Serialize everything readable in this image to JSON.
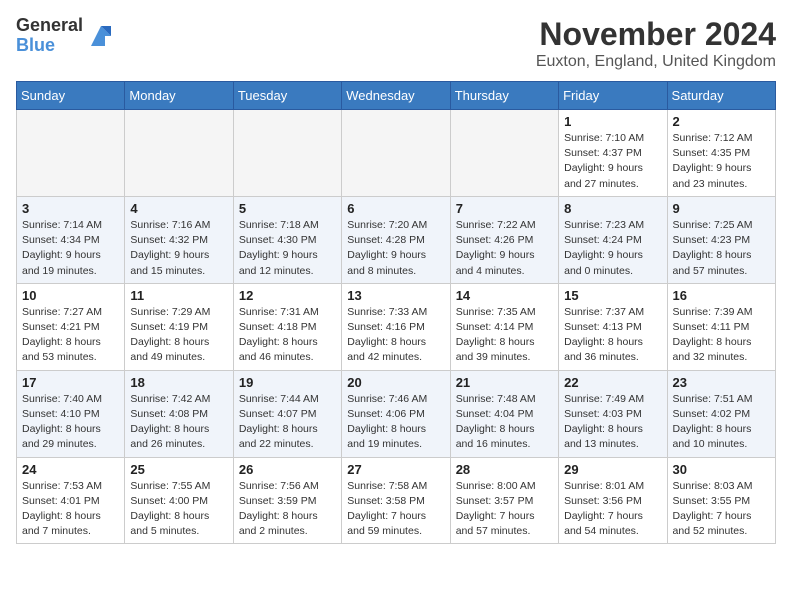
{
  "header": {
    "logo_general": "General",
    "logo_blue": "Blue",
    "month_title": "November 2024",
    "location": "Euxton, England, United Kingdom"
  },
  "days_of_week": [
    "Sunday",
    "Monday",
    "Tuesday",
    "Wednesday",
    "Thursday",
    "Friday",
    "Saturday"
  ],
  "weeks": [
    [
      {
        "day": "",
        "info": ""
      },
      {
        "day": "",
        "info": ""
      },
      {
        "day": "",
        "info": ""
      },
      {
        "day": "",
        "info": ""
      },
      {
        "day": "",
        "info": ""
      },
      {
        "day": "1",
        "info": "Sunrise: 7:10 AM\nSunset: 4:37 PM\nDaylight: 9 hours and 27 minutes."
      },
      {
        "day": "2",
        "info": "Sunrise: 7:12 AM\nSunset: 4:35 PM\nDaylight: 9 hours and 23 minutes."
      }
    ],
    [
      {
        "day": "3",
        "info": "Sunrise: 7:14 AM\nSunset: 4:34 PM\nDaylight: 9 hours and 19 minutes."
      },
      {
        "day": "4",
        "info": "Sunrise: 7:16 AM\nSunset: 4:32 PM\nDaylight: 9 hours and 15 minutes."
      },
      {
        "day": "5",
        "info": "Sunrise: 7:18 AM\nSunset: 4:30 PM\nDaylight: 9 hours and 12 minutes."
      },
      {
        "day": "6",
        "info": "Sunrise: 7:20 AM\nSunset: 4:28 PM\nDaylight: 9 hours and 8 minutes."
      },
      {
        "day": "7",
        "info": "Sunrise: 7:22 AM\nSunset: 4:26 PM\nDaylight: 9 hours and 4 minutes."
      },
      {
        "day": "8",
        "info": "Sunrise: 7:23 AM\nSunset: 4:24 PM\nDaylight: 9 hours and 0 minutes."
      },
      {
        "day": "9",
        "info": "Sunrise: 7:25 AM\nSunset: 4:23 PM\nDaylight: 8 hours and 57 minutes."
      }
    ],
    [
      {
        "day": "10",
        "info": "Sunrise: 7:27 AM\nSunset: 4:21 PM\nDaylight: 8 hours and 53 minutes."
      },
      {
        "day": "11",
        "info": "Sunrise: 7:29 AM\nSunset: 4:19 PM\nDaylight: 8 hours and 49 minutes."
      },
      {
        "day": "12",
        "info": "Sunrise: 7:31 AM\nSunset: 4:18 PM\nDaylight: 8 hours and 46 minutes."
      },
      {
        "day": "13",
        "info": "Sunrise: 7:33 AM\nSunset: 4:16 PM\nDaylight: 8 hours and 42 minutes."
      },
      {
        "day": "14",
        "info": "Sunrise: 7:35 AM\nSunset: 4:14 PM\nDaylight: 8 hours and 39 minutes."
      },
      {
        "day": "15",
        "info": "Sunrise: 7:37 AM\nSunset: 4:13 PM\nDaylight: 8 hours and 36 minutes."
      },
      {
        "day": "16",
        "info": "Sunrise: 7:39 AM\nSunset: 4:11 PM\nDaylight: 8 hours and 32 minutes."
      }
    ],
    [
      {
        "day": "17",
        "info": "Sunrise: 7:40 AM\nSunset: 4:10 PM\nDaylight: 8 hours and 29 minutes."
      },
      {
        "day": "18",
        "info": "Sunrise: 7:42 AM\nSunset: 4:08 PM\nDaylight: 8 hours and 26 minutes."
      },
      {
        "day": "19",
        "info": "Sunrise: 7:44 AM\nSunset: 4:07 PM\nDaylight: 8 hours and 22 minutes."
      },
      {
        "day": "20",
        "info": "Sunrise: 7:46 AM\nSunset: 4:06 PM\nDaylight: 8 hours and 19 minutes."
      },
      {
        "day": "21",
        "info": "Sunrise: 7:48 AM\nSunset: 4:04 PM\nDaylight: 8 hours and 16 minutes."
      },
      {
        "day": "22",
        "info": "Sunrise: 7:49 AM\nSunset: 4:03 PM\nDaylight: 8 hours and 13 minutes."
      },
      {
        "day": "23",
        "info": "Sunrise: 7:51 AM\nSunset: 4:02 PM\nDaylight: 8 hours and 10 minutes."
      }
    ],
    [
      {
        "day": "24",
        "info": "Sunrise: 7:53 AM\nSunset: 4:01 PM\nDaylight: 8 hours and 7 minutes."
      },
      {
        "day": "25",
        "info": "Sunrise: 7:55 AM\nSunset: 4:00 PM\nDaylight: 8 hours and 5 minutes."
      },
      {
        "day": "26",
        "info": "Sunrise: 7:56 AM\nSunset: 3:59 PM\nDaylight: 8 hours and 2 minutes."
      },
      {
        "day": "27",
        "info": "Sunrise: 7:58 AM\nSunset: 3:58 PM\nDaylight: 7 hours and 59 minutes."
      },
      {
        "day": "28",
        "info": "Sunrise: 8:00 AM\nSunset: 3:57 PM\nDaylight: 7 hours and 57 minutes."
      },
      {
        "day": "29",
        "info": "Sunrise: 8:01 AM\nSunset: 3:56 PM\nDaylight: 7 hours and 54 minutes."
      },
      {
        "day": "30",
        "info": "Sunrise: 8:03 AM\nSunset: 3:55 PM\nDaylight: 7 hours and 52 minutes."
      }
    ]
  ],
  "row_colors": [
    "white",
    "gray",
    "white",
    "gray",
    "white"
  ]
}
